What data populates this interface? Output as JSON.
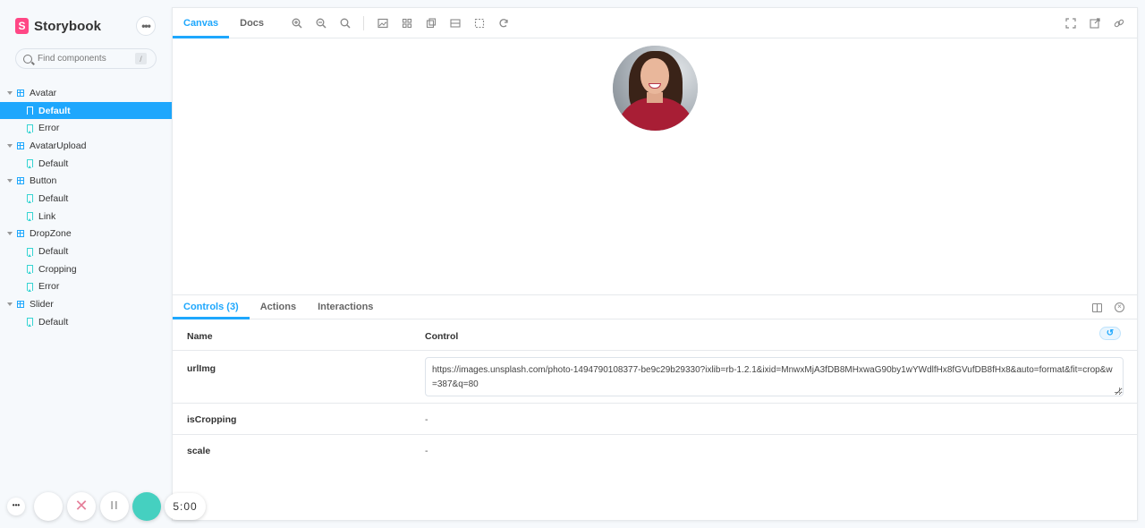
{
  "sidebar": {
    "brand": "Storybook",
    "menu_label": "•••",
    "search": {
      "placeholder": "Find components",
      "shortcut": "/"
    },
    "tree": [
      {
        "type": "group",
        "label": "Avatar"
      },
      {
        "type": "story",
        "label": "Default",
        "selected": true
      },
      {
        "type": "story",
        "label": "Error"
      },
      {
        "type": "group",
        "label": "AvatarUpload"
      },
      {
        "type": "story",
        "label": "Default"
      },
      {
        "type": "group",
        "label": "Button"
      },
      {
        "type": "story",
        "label": "Default"
      },
      {
        "type": "story",
        "label": "Link"
      },
      {
        "type": "group",
        "label": "DropZone"
      },
      {
        "type": "story",
        "label": "Default"
      },
      {
        "type": "story",
        "label": "Cropping"
      },
      {
        "type": "story",
        "label": "Error"
      },
      {
        "type": "group",
        "label": "Slider"
      },
      {
        "type": "story",
        "label": "Default"
      }
    ]
  },
  "toolbar": {
    "tabs": [
      {
        "label": "Canvas",
        "active": true
      },
      {
        "label": "Docs",
        "active": false
      }
    ]
  },
  "addons": {
    "tabs": [
      {
        "label": "Controls (3)",
        "active": true
      },
      {
        "label": "Actions",
        "active": false
      },
      {
        "label": "Interactions",
        "active": false
      }
    ],
    "table": {
      "col_name": "Name",
      "col_control": "Control",
      "rows": [
        {
          "name": "urlImg",
          "value": "https://images.unsplash.com/photo-1494790108377-be9c29b29330?ixlib=rb-1.2.1&ixid=MnwxMjA3fDB8MHxwaG90by1wYWdlfHx8fGVufDB8fHx8&auto=format&fit=crop&w=387&q=80"
        },
        {
          "name": "isCropping",
          "value": "-"
        },
        {
          "name": "scale",
          "value": "-"
        }
      ]
    }
  },
  "recorder": {
    "menu": "•••",
    "time": "5:00"
  },
  "colors": {
    "accent": "#1ea7fd",
    "brand": "#ff4785",
    "story_icon": "#37d5d3",
    "record": "#45d0c0"
  }
}
